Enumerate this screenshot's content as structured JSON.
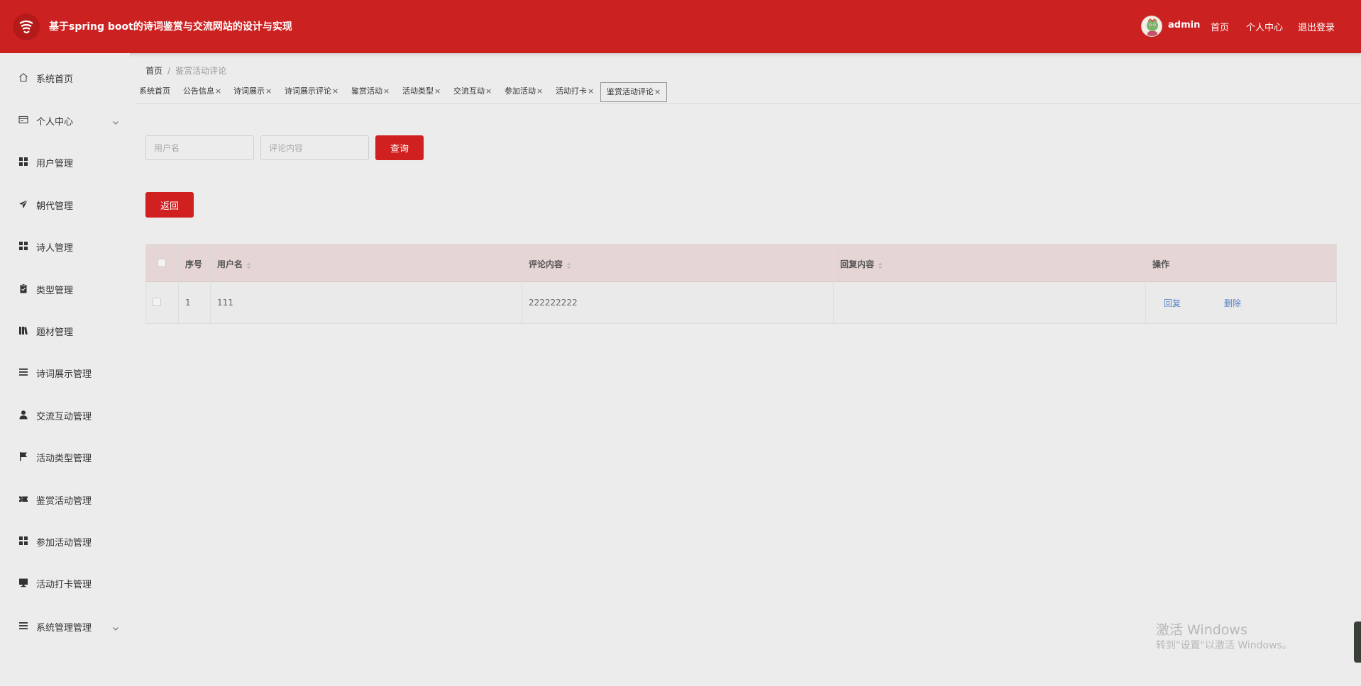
{
  "header": {
    "title": "基于spring boot的诗词鉴赏与交流网站的设计与实现",
    "username": "admin",
    "nav": [
      "首页",
      "个人中心",
      "退出登录"
    ]
  },
  "sidebar": {
    "items": [
      {
        "label": "系统首页",
        "icon": "home-icon"
      },
      {
        "label": "个人中心",
        "icon": "id-card-icon",
        "expandable": true
      },
      {
        "label": "用户管理",
        "icon": "grid-icon"
      },
      {
        "label": "朝代管理",
        "icon": "paper-plane-icon"
      },
      {
        "label": "诗人管理",
        "icon": "grid-icon"
      },
      {
        "label": "类型管理",
        "icon": "clipboard-icon"
      },
      {
        "label": "题材管理",
        "icon": "books-icon"
      },
      {
        "label": "诗词展示管理",
        "icon": "list-icon"
      },
      {
        "label": "交流互动管理",
        "icon": "user-icon"
      },
      {
        "label": "活动类型管理",
        "icon": "flag-icon"
      },
      {
        "label": "鉴赏活动管理",
        "icon": "ticket-icon"
      },
      {
        "label": "参加活动管理",
        "icon": "grid-icon"
      },
      {
        "label": "活动打卡管理",
        "icon": "monitor-icon"
      },
      {
        "label": "系统管理管理",
        "icon": "list-icon",
        "expandable": true
      }
    ]
  },
  "breadcrumb": {
    "home": "首页",
    "separator": "/",
    "current": "鉴赏活动评论"
  },
  "tags": [
    {
      "label": "系统首页",
      "closable": false
    },
    {
      "label": "公告信息",
      "closable": true
    },
    {
      "label": "诗词展示",
      "closable": true
    },
    {
      "label": "诗词展示评论",
      "closable": true
    },
    {
      "label": "鉴赏活动",
      "closable": true
    },
    {
      "label": "活动类型",
      "closable": true
    },
    {
      "label": "交流互动",
      "closable": true
    },
    {
      "label": "参加活动",
      "closable": true
    },
    {
      "label": "活动打卡",
      "closable": true
    },
    {
      "label": "鉴赏活动评论",
      "closable": true,
      "active": true
    }
  ],
  "tag_close_glyph": "×",
  "search": {
    "username_placeholder": "用户名",
    "content_placeholder": "评论内容",
    "query_label": "查询"
  },
  "back_label": "返回",
  "table": {
    "headers": {
      "index": "序号",
      "username": "用户名",
      "content": "评论内容",
      "reply": "回复内容",
      "actions": "操作"
    },
    "rows": [
      {
        "index": "1",
        "username": "111",
        "content": "222222222",
        "reply": ""
      }
    ],
    "actions": {
      "reply": "回复",
      "delete": "删除"
    }
  },
  "watermark": {
    "title": "激活 Windows",
    "subtitle": "转到\"设置\"以激活 Windows。"
  },
  "colors": {
    "brand_red": "#cc2121",
    "button_red": "#d0201f",
    "table_header_bg": "#e6d5d5",
    "link_blue": "#5a83c5",
    "page_bg": "#ececec"
  }
}
